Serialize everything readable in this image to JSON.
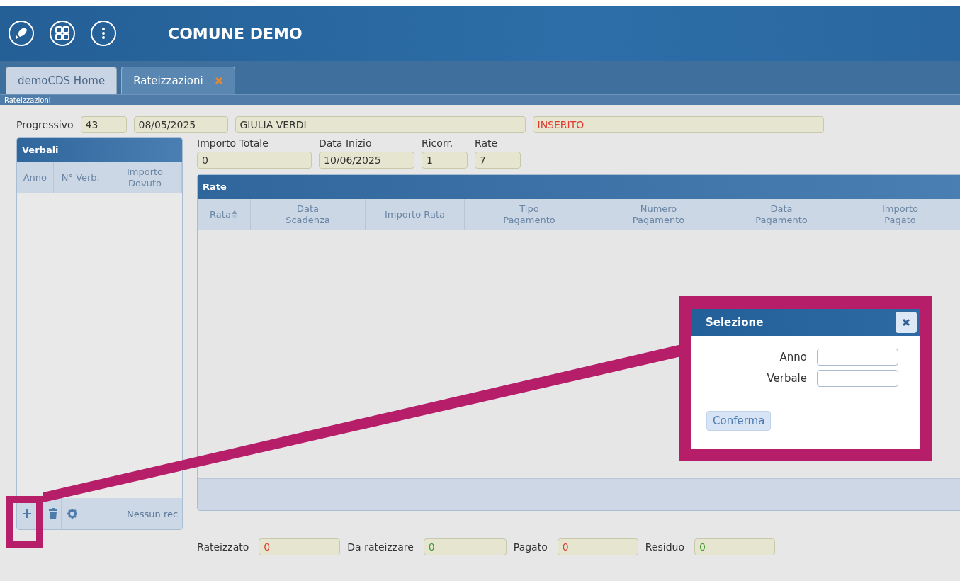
{
  "header": {
    "title": "COMUNE DEMO"
  },
  "tabs": [
    {
      "label": "demoCDS Home",
      "selected": false,
      "closable": false
    },
    {
      "label": "Rateizzazioni",
      "selected": true,
      "closable": true
    }
  ],
  "breadcrumb": "Rateizzazioni",
  "record": {
    "label": "Progressivo",
    "fields": [
      {
        "value": "43",
        "color": "#333333"
      },
      {
        "value": "08/05/2025",
        "color": "#333333"
      },
      {
        "value": "GIULIA VERDI",
        "color": "#333333"
      },
      {
        "value": "INSERITO",
        "color": "#e03c31"
      }
    ]
  },
  "verbali": {
    "title": "Verbali",
    "columns": [
      "Anno",
      "N° Verb.",
      "Importo Dovuto"
    ],
    "toolbar_status": "Nessun rec"
  },
  "plan": {
    "fields": [
      {
        "label": "Importo Totale",
        "value": "0"
      },
      {
        "label": "Data Inizio",
        "value": "10/06/2025"
      },
      {
        "label": "Ricorr.",
        "value": "1"
      },
      {
        "label": "Rate",
        "value": "7"
      }
    ]
  },
  "rate": {
    "title": "Rate",
    "columns": [
      {
        "label": "Rata",
        "sortable": true
      },
      {
        "label": "Data Scadenza",
        "sortable": false
      },
      {
        "label": "Importo Rata",
        "sortable": false
      },
      {
        "label": "Tipo Pagamento",
        "sortable": false
      },
      {
        "label": "Numero Pagamento",
        "sortable": false
      },
      {
        "label": "Data Pagamento",
        "sortable": false
      },
      {
        "label": "Importo Pagato",
        "sortable": false
      }
    ]
  },
  "totals": [
    {
      "label": "Rateizzato",
      "value": "0",
      "color": "#e03c31"
    },
    {
      "label": "Da rateizzare",
      "value": "0",
      "color": "#3f9a2f"
    },
    {
      "label": "Pagato",
      "value": "0",
      "color": "#e03c31"
    },
    {
      "label": "Residuo",
      "value": "0",
      "color": "#3f9a2f"
    }
  ],
  "dialog": {
    "title": "Selezione",
    "fields": [
      {
        "label": "Anno"
      },
      {
        "label": "Verbale"
      }
    ],
    "button": "Conferma"
  }
}
